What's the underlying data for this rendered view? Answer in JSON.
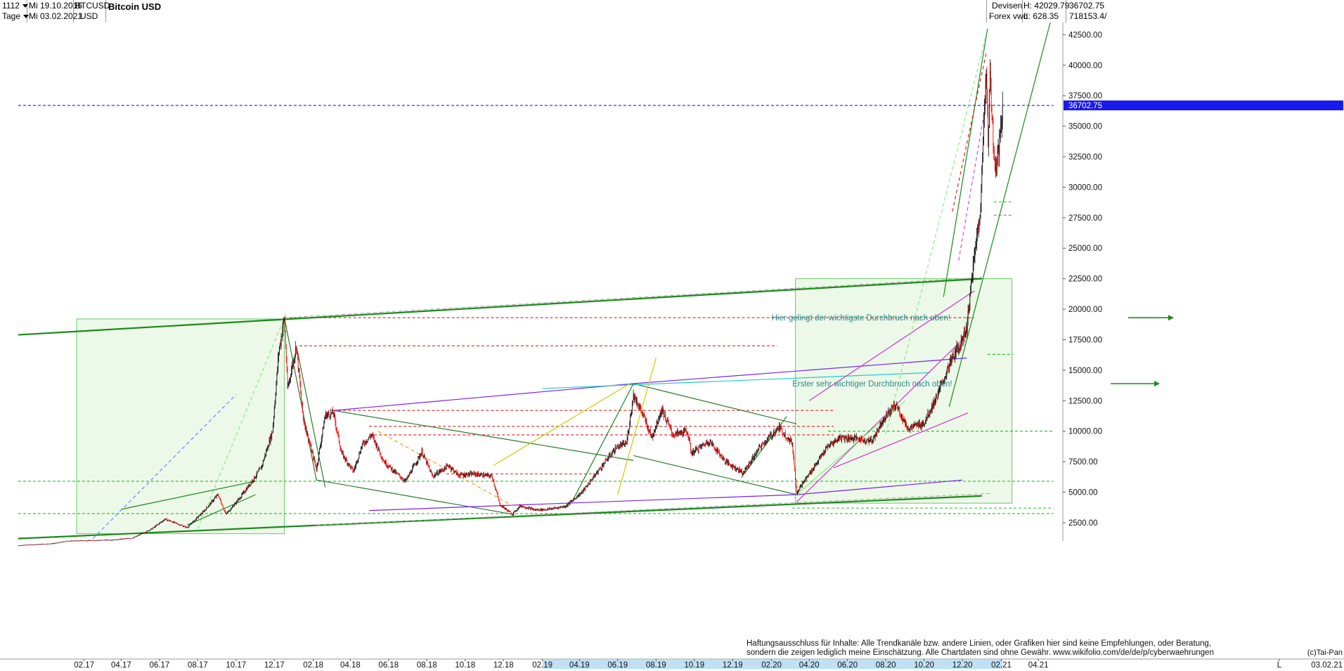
{
  "toolbar": {
    "bars_count": "1112",
    "period": "Tage",
    "date_from": "Mi 19.10.2016",
    "date_to": "Mi 03.02.2021",
    "symbol": "BTCUSD",
    "currency": "USD",
    "title": "Bitcoin USD",
    "market": "Devisen",
    "exchange": "Forex vwd",
    "high_label": "H: 42029.79",
    "low_label": "L: 628.35",
    "last_value": "36702.75",
    "volume_value": "718153.4/"
  },
  "chart_data": {
    "type": "candlestick",
    "title": "Bitcoin USD",
    "y_ticks": [
      "2500.00",
      "5000.00",
      "7500.00",
      "10000.00",
      "12500.00",
      "15000.00",
      "17500.00",
      "20000.00",
      "22500.00",
      "25000.00",
      "27500.00",
      "30000.00",
      "32500.00",
      "35000.00",
      "37500.00",
      "40000.00",
      "42500.00"
    ],
    "ylim": [
      1000,
      43500
    ],
    "x_labels": [
      "02.17",
      "04.17",
      "06.17",
      "08.17",
      "10.17",
      "12.17",
      "02.18",
      "04.18",
      "06.18",
      "08.18",
      "10.18",
      "12.18",
      "02.19",
      "04.19",
      "06.19",
      "08.19",
      "10.19",
      "12.19",
      "02.20",
      "04.20",
      "06.20",
      "08.20",
      "10.20",
      "12.20",
      "02.21",
      "04.21",
      "L"
    ],
    "x_label_dates": [
      "2017-02-01",
      "2017-04-01",
      "2017-06-01",
      "2017-08-01",
      "2017-10-01",
      "2017-12-01",
      "2018-02-01",
      "2018-04-01",
      "2018-06-01",
      "2018-08-01",
      "2018-10-01",
      "2018-12-01",
      "2019-02-01",
      "2019-04-01",
      "2019-06-01",
      "2019-08-01",
      "2019-10-01",
      "2019-12-01",
      "2020-02-01",
      "2020-04-01",
      "2020-06-01",
      "2020-08-01",
      "2020-10-01",
      "2020-12-01",
      "2021-02-01",
      "2021-04-01"
    ],
    "last_price": 36702.75,
    "last_price_label": "36702.75",
    "last_date_label": "03.02.21",
    "x_start": "2016-10-19",
    "x_end": "2021-02-03",
    "price_path": [
      [
        "2016-10-19",
        640
      ],
      [
        "2016-12-15",
        800
      ],
      [
        "2017-01-05",
        1000
      ],
      [
        "2017-02-15",
        1050
      ],
      [
        "2017-03-20",
        1100
      ],
      [
        "2017-04-20",
        1250
      ],
      [
        "2017-05-20",
        2000
      ],
      [
        "2017-06-10",
        2800
      ],
      [
        "2017-07-15",
        2100
      ],
      [
        "2017-08-10",
        3400
      ],
      [
        "2017-09-02",
        4800
      ],
      [
        "2017-09-15",
        3200
      ],
      [
        "2017-10-05",
        4400
      ],
      [
        "2017-10-25",
        5800
      ],
      [
        "2017-11-10",
        7000
      ],
      [
        "2017-11-28",
        10000
      ],
      [
        "2017-12-08",
        16500
      ],
      [
        "2017-12-17",
        19300
      ],
      [
        "2017-12-22",
        13500
      ],
      [
        "2018-01-05",
        17000
      ],
      [
        "2018-01-16",
        11000
      ],
      [
        "2018-02-06",
        6900
      ],
      [
        "2018-02-20",
        11300
      ],
      [
        "2018-03-05",
        11500
      ],
      [
        "2018-03-18",
        8200
      ],
      [
        "2018-04-06",
        6700
      ],
      [
        "2018-04-20",
        8900
      ],
      [
        "2018-05-05",
        9700
      ],
      [
        "2018-05-25",
        7500
      ],
      [
        "2018-06-12",
        6600
      ],
      [
        "2018-06-28",
        5900
      ],
      [
        "2018-07-24",
        8300
      ],
      [
        "2018-08-10",
        6300
      ],
      [
        "2018-09-05",
        7200
      ],
      [
        "2018-09-20",
        6400
      ],
      [
        "2018-10-15",
        6500
      ],
      [
        "2018-11-13",
        6300
      ],
      [
        "2018-11-25",
        4000
      ],
      [
        "2018-12-15",
        3200
      ],
      [
        "2018-12-28",
        3900
      ],
      [
        "2019-01-20",
        3550
      ],
      [
        "2019-02-10",
        3600
      ],
      [
        "2019-03-10",
        3850
      ],
      [
        "2019-04-05",
        5000
      ],
      [
        "2019-05-12",
        7500
      ],
      [
        "2019-05-30",
        8700
      ],
      [
        "2019-06-15",
        9000
      ],
      [
        "2019-06-26",
        13000
      ],
      [
        "2019-07-10",
        11500
      ],
      [
        "2019-07-25",
        9500
      ],
      [
        "2019-08-10",
        11800
      ],
      [
        "2019-08-28",
        9700
      ],
      [
        "2019-09-20",
        10000
      ],
      [
        "2019-09-26",
        8200
      ],
      [
        "2019-10-25",
        9200
      ],
      [
        "2019-11-20",
        7500
      ],
      [
        "2019-12-18",
        6600
      ],
      [
        "2020-01-15",
        8800
      ],
      [
        "2020-02-13",
        10300
      ],
      [
        "2020-03-05",
        9000
      ],
      [
        "2020-03-12",
        5000
      ],
      [
        "2020-04-01",
        6500
      ],
      [
        "2020-04-30",
        8700
      ],
      [
        "2020-05-20",
        9500
      ],
      [
        "2020-06-15",
        9400
      ],
      [
        "2020-07-10",
        9200
      ],
      [
        "2020-07-28",
        11000
      ],
      [
        "2020-08-17",
        12200
      ],
      [
        "2020-09-05",
        10200
      ],
      [
        "2020-10-01",
        10700
      ],
      [
        "2020-10-21",
        12800
      ],
      [
        "2020-11-15",
        16000
      ],
      [
        "2020-11-26",
        17000
      ],
      [
        "2020-12-08",
        18500
      ],
      [
        "2020-12-17",
        23000
      ],
      [
        "2020-12-30",
        28500
      ],
      [
        "2021-01-08",
        40000
      ],
      [
        "2021-01-11",
        34000
      ],
      [
        "2021-01-14",
        39000
      ],
      [
        "2021-01-22",
        31000
      ],
      [
        "2021-01-28",
        33000
      ],
      [
        "2021-02-03",
        36702.75
      ]
    ],
    "annotations": [
      {
        "text": "Hier gelingt der wichtigste Durchbruch nach oben!",
        "x": "2020-02-01",
        "y": 19300
      },
      {
        "text": "Erster sehr wichtiger Durchbruch nach oben!",
        "x": "2020-03-05",
        "y": 13900
      }
    ],
    "disclaimer_lines": [
      "Haftungsausschluss für Inhalte: Alle Trendkanäle bzw. andere Linien, oder Grafiken hier sind keine Empfehlungen, oder Beratung,",
      "sondern die zeigen lediglich meine  Einschätzung. Alle Chartdaten sind ohne Gewähr.  www.wikifolio.com/de/de/p/cyberwaehrungen"
    ],
    "copyright": "(c)Tai-Pan",
    "horizontal_levels": [
      {
        "y": 19300,
        "color": "#dd2222",
        "from": "2017-12-17",
        "to": "2020-12-20"
      },
      {
        "y": 17000,
        "color": "#dd2222",
        "from": "2018-01-10",
        "to": "2020-02-10"
      },
      {
        "y": 11700,
        "color": "#dd2222",
        "from": "2018-03-05",
        "to": "2020-05-10"
      },
      {
        "y": 10400,
        "color": "#dd2222",
        "from": "2018-05-01",
        "to": "2020-05-10"
      },
      {
        "y": 9700,
        "color": "#dd2222",
        "from": "2018-05-01",
        "to": "2020-05-10"
      },
      {
        "y": 6500,
        "color": "#dd2222",
        "from": "2018-09-01",
        "to": "2019-04-20"
      },
      {
        "y": 5900,
        "color": "#22bb22",
        "from": "2016-10-19",
        "to": "2021-04-25"
      },
      {
        "y": 3250,
        "color": "#22bb22",
        "from": "2016-10-19",
        "to": "2021-04-25"
      },
      {
        "y": 3700,
        "color": "#22bb22",
        "from": "2020-03-05",
        "to": "2021-04-25"
      },
      {
        "y": 10000,
        "color": "#22bb22",
        "from": "2020-05-01",
        "to": "2021-04-25"
      },
      {
        "y": 28800,
        "color": "#22bb22",
        "from": "2021-01-20",
        "to": "2021-02-20"
      },
      {
        "y": 27700,
        "color": "#22bb22",
        "from": "2021-01-20",
        "to": "2021-02-20"
      },
      {
        "y": 16300,
        "color": "#22bb22",
        "from": "2021-01-10",
        "to": "2021-02-20"
      },
      {
        "y": 36702.75,
        "color": "#1a1aee",
        "from": "2016-10-19",
        "to": "2021-04-25"
      }
    ],
    "trend_lines": [
      {
        "color": "#1a8a1a",
        "w": 2.2,
        "dash": "",
        "p": [
          [
            "2016-10-19",
            17900
          ],
          [
            "2021-01-01",
            22500
          ]
        ]
      },
      {
        "color": "#1a8a1a",
        "w": 2.2,
        "dash": "",
        "p": [
          [
            "2016-10-19",
            1200
          ],
          [
            "2021-01-01",
            4700
          ]
        ]
      },
      {
        "color": "#aaaaaa",
        "w": 1,
        "dash": "6,3",
        "p": [
          [
            "2017-12-17",
            19300
          ],
          [
            "2021-01-01",
            22600
          ]
        ]
      },
      {
        "color": "#aaaaaa",
        "w": 1,
        "dash": "6,3",
        "p": [
          [
            "2018-02-06",
            2300
          ],
          [
            "2021-01-15",
            4900
          ]
        ]
      },
      {
        "color": "#2a7a2a",
        "w": 1.2,
        "dash": "",
        "p": [
          [
            "2017-12-17",
            19300
          ],
          [
            "2018-02-06",
            6000
          ]
        ]
      },
      {
        "color": "#2a7a2a",
        "w": 1.2,
        "dash": "",
        "p": [
          [
            "2018-01-05",
            17000
          ],
          [
            "2018-02-20",
            5400
          ]
        ]
      },
      {
        "color": "#2a7a2a",
        "w": 1.2,
        "dash": "",
        "p": [
          [
            "2018-03-05",
            11700
          ],
          [
            "2019-06-26",
            7600
          ]
        ]
      },
      {
        "color": "#2a7a2a",
        "w": 1.2,
        "dash": "",
        "p": [
          [
            "2018-02-06",
            6000
          ],
          [
            "2018-12-15",
            3200
          ]
        ]
      },
      {
        "color": "#7a22ee",
        "w": 1.2,
        "dash": "",
        "p": [
          [
            "2018-03-05",
            11700
          ],
          [
            "2019-06-26",
            13900
          ]
        ]
      },
      {
        "color": "#7a22ee",
        "w": 1.2,
        "dash": "",
        "p": [
          [
            "2019-06-26",
            13900
          ],
          [
            "2020-12-08",
            16000
          ]
        ]
      },
      {
        "color": "#7a22ee",
        "w": 1.2,
        "dash": "",
        "p": [
          [
            "2018-05-01",
            3500
          ],
          [
            "2020-03-12",
            4800
          ]
        ]
      },
      {
        "color": "#7a22ee",
        "w": 1.2,
        "dash": "",
        "p": [
          [
            "2020-03-12",
            4800
          ],
          [
            "2020-12-01",
            6000
          ]
        ]
      },
      {
        "color": "#2a7a2a",
        "w": 1.2,
        "dash": "",
        "p": [
          [
            "2019-06-26",
            13900
          ],
          [
            "2020-03-12",
            10600
          ]
        ]
      },
      {
        "color": "#2a7a2a",
        "w": 1.2,
        "dash": "",
        "p": [
          [
            "2019-06-26",
            8000
          ],
          [
            "2020-03-12",
            4800
          ]
        ]
      },
      {
        "color": "#22cccc",
        "w": 1.2,
        "dash": "",
        "p": [
          [
            "2019-02-01",
            13500
          ],
          [
            "2020-10-10",
            14800
          ]
        ]
      },
      {
        "color": "#cc33cc",
        "w": 1.2,
        "dash": "",
        "p": [
          [
            "2020-04-01",
            12500
          ],
          [
            "2020-12-20",
            21500
          ]
        ]
      },
      {
        "color": "#cc33cc",
        "w": 1.2,
        "dash": "",
        "p": [
          [
            "2020-03-12",
            4200
          ],
          [
            "2020-12-01",
            17500
          ]
        ]
      },
      {
        "color": "#cc33cc",
        "w": 1.2,
        "dash": "",
        "p": [
          [
            "2020-05-10",
            7000
          ],
          [
            "2020-12-10",
            11500
          ]
        ]
      },
      {
        "color": "#1a8a1a",
        "w": 1.2,
        "dash": "",
        "p": [
          [
            "2020-11-10",
            12000
          ],
          [
            "2021-04-20",
            43500
          ]
        ]
      },
      {
        "color": "#1a8a1a",
        "w": 1.2,
        "dash": "",
        "p": [
          [
            "2020-11-01",
            21000
          ],
          [
            "2021-01-10",
            43000
          ]
        ]
      },
      {
        "color": "#1a8a1a",
        "w": 1.2,
        "dash": "",
        "p": [
          [
            "2019-03-20",
            4200
          ],
          [
            "2019-06-26",
            13900
          ]
        ]
      },
      {
        "color": "#1a8a1a",
        "w": 1.2,
        "dash": "",
        "p": [
          [
            "2019-12-15",
            6200
          ],
          [
            "2020-02-25",
            11200
          ]
        ]
      },
      {
        "color": "#1a8a1a",
        "w": 1.2,
        "dash": "",
        "p": [
          [
            "2017-07-15",
            2300
          ],
          [
            "2017-11-01",
            4800
          ]
        ]
      },
      {
        "color": "#1a8a1a",
        "w": 1.2,
        "dash": "",
        "p": [
          [
            "2017-04-01",
            3600
          ],
          [
            "2017-11-01",
            5900
          ]
        ]
      },
      {
        "color": "#dd2222",
        "w": 1.2,
        "dash": "5,4",
        "p": [
          [
            "2020-11-15",
            28000
          ],
          [
            "2021-01-08",
            41000
          ]
        ]
      },
      {
        "color": "#dd44dd",
        "w": 1.2,
        "dash": "5,4",
        "p": [
          [
            "2020-11-25",
            24000
          ],
          [
            "2021-01-08",
            37000
          ]
        ]
      },
      {
        "color": "#6688ff",
        "w": 1.2,
        "dash": "5,4",
        "p": [
          [
            "2017-02-15",
            1200
          ],
          [
            "2017-10-01",
            13000
          ]
        ]
      },
      {
        "color": "#ff9900",
        "w": 1.2,
        "dash": "5,4",
        "p": [
          [
            "2018-05-15",
            10000
          ],
          [
            "2018-12-15",
            3900
          ]
        ]
      },
      {
        "color": "#cccc00",
        "w": 1.2,
        "dash": "",
        "p": [
          [
            "2019-06-01",
            4800
          ],
          [
            "2019-08-01",
            16000
          ]
        ]
      },
      {
        "color": "#cccc00",
        "w": 1.2,
        "dash": "",
        "p": [
          [
            "2018-11-15",
            7200
          ],
          [
            "2019-06-20",
            13900
          ]
        ]
      },
      {
        "color": "#66ee66",
        "w": 1,
        "dash": "5,4",
        "p": [
          [
            "2017-08-01",
            2000
          ],
          [
            "2017-12-17",
            19300
          ]
        ]
      },
      {
        "color": "#66ee66",
        "w": 1,
        "dash": "5,4",
        "p": [
          [
            "2020-08-01",
            9800
          ],
          [
            "2021-01-08",
            42500
          ]
        ]
      },
      {
        "color": "#66ee66",
        "w": 1,
        "dash": "",
        "p": [
          [
            "2020-03-12",
            4800
          ],
          [
            "2020-09-01",
            12500
          ]
        ]
      }
    ],
    "zones": [
      {
        "from": "2017-01-20",
        "to": "2017-12-17",
        "y0": 1600,
        "y1": 19200
      },
      {
        "from": "2020-03-10",
        "to": "2021-02-18",
        "y0": 4100,
        "y1": 22500
      }
    ]
  }
}
